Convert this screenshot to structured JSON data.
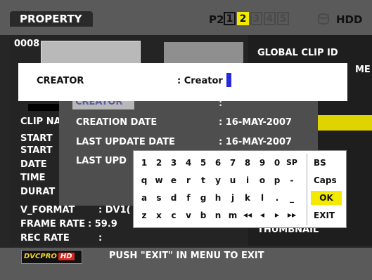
{
  "header": {
    "title": "PROPERTY",
    "p2_label": "P2",
    "slots": [
      "1",
      "2",
      "3",
      "4",
      "5"
    ],
    "hdd_label": "HDD"
  },
  "left": {
    "clip_number": "0008",
    "labels": [
      "CLIP NA",
      "START",
      "START",
      "DATE",
      "TIME",
      "DURAT"
    ],
    "v_format_label": "V_FORMAT",
    "v_format_value": ": DV1(",
    "frame_rate_label": "FRAME RATE",
    "frame_rate_value": ": 59.9",
    "rec_rate_label": "REC RATE",
    "rec_rate_value": ":"
  },
  "right": {
    "global_clip_id": "GLOBAL CLIP ID",
    "me_fragment": "ME",
    "thumbnail": "THUMBNAIL"
  },
  "edit": {
    "label": "CREATOR",
    "value": ": Creator"
  },
  "dialog": {
    "creator_label": "CREATOR",
    "creator_colon": ":",
    "rows": [
      {
        "label": "CREATION DATE",
        "value": ":   16-MAY-2007"
      },
      {
        "label": "LAST UPDATE DATE",
        "value": ":   16-MAY-2007"
      },
      {
        "label": "LAST UPD",
        "value": ""
      }
    ]
  },
  "keyboard": {
    "rows": [
      [
        "1",
        "2",
        "3",
        "4",
        "5",
        "6",
        "7",
        "8",
        "9",
        "0",
        "SP"
      ],
      [
        "q",
        "w",
        "e",
        "r",
        "t",
        "y",
        "u",
        "i",
        "o",
        "p",
        "-"
      ],
      [
        "a",
        "s",
        "d",
        "f",
        "g",
        "h",
        "j",
        "k",
        "l",
        ".",
        "_"
      ],
      [
        "z",
        "x",
        "c",
        "v",
        "b",
        "n",
        "m",
        "◀◀",
        "◀",
        "▶",
        "▶▶"
      ]
    ],
    "side": [
      "BS",
      "Caps",
      "OK",
      "EXIT"
    ]
  },
  "footer": {
    "badge_dv": "DVCPRO",
    "badge_hd": "HD",
    "message": "PUSH \"EXIT\" IN MENU TO EXIT"
  },
  "colors": {
    "accent_yellow": "#f3ea00",
    "cursor_blue": "#2a2adc",
    "header_gray": "#5a5a5a"
  }
}
